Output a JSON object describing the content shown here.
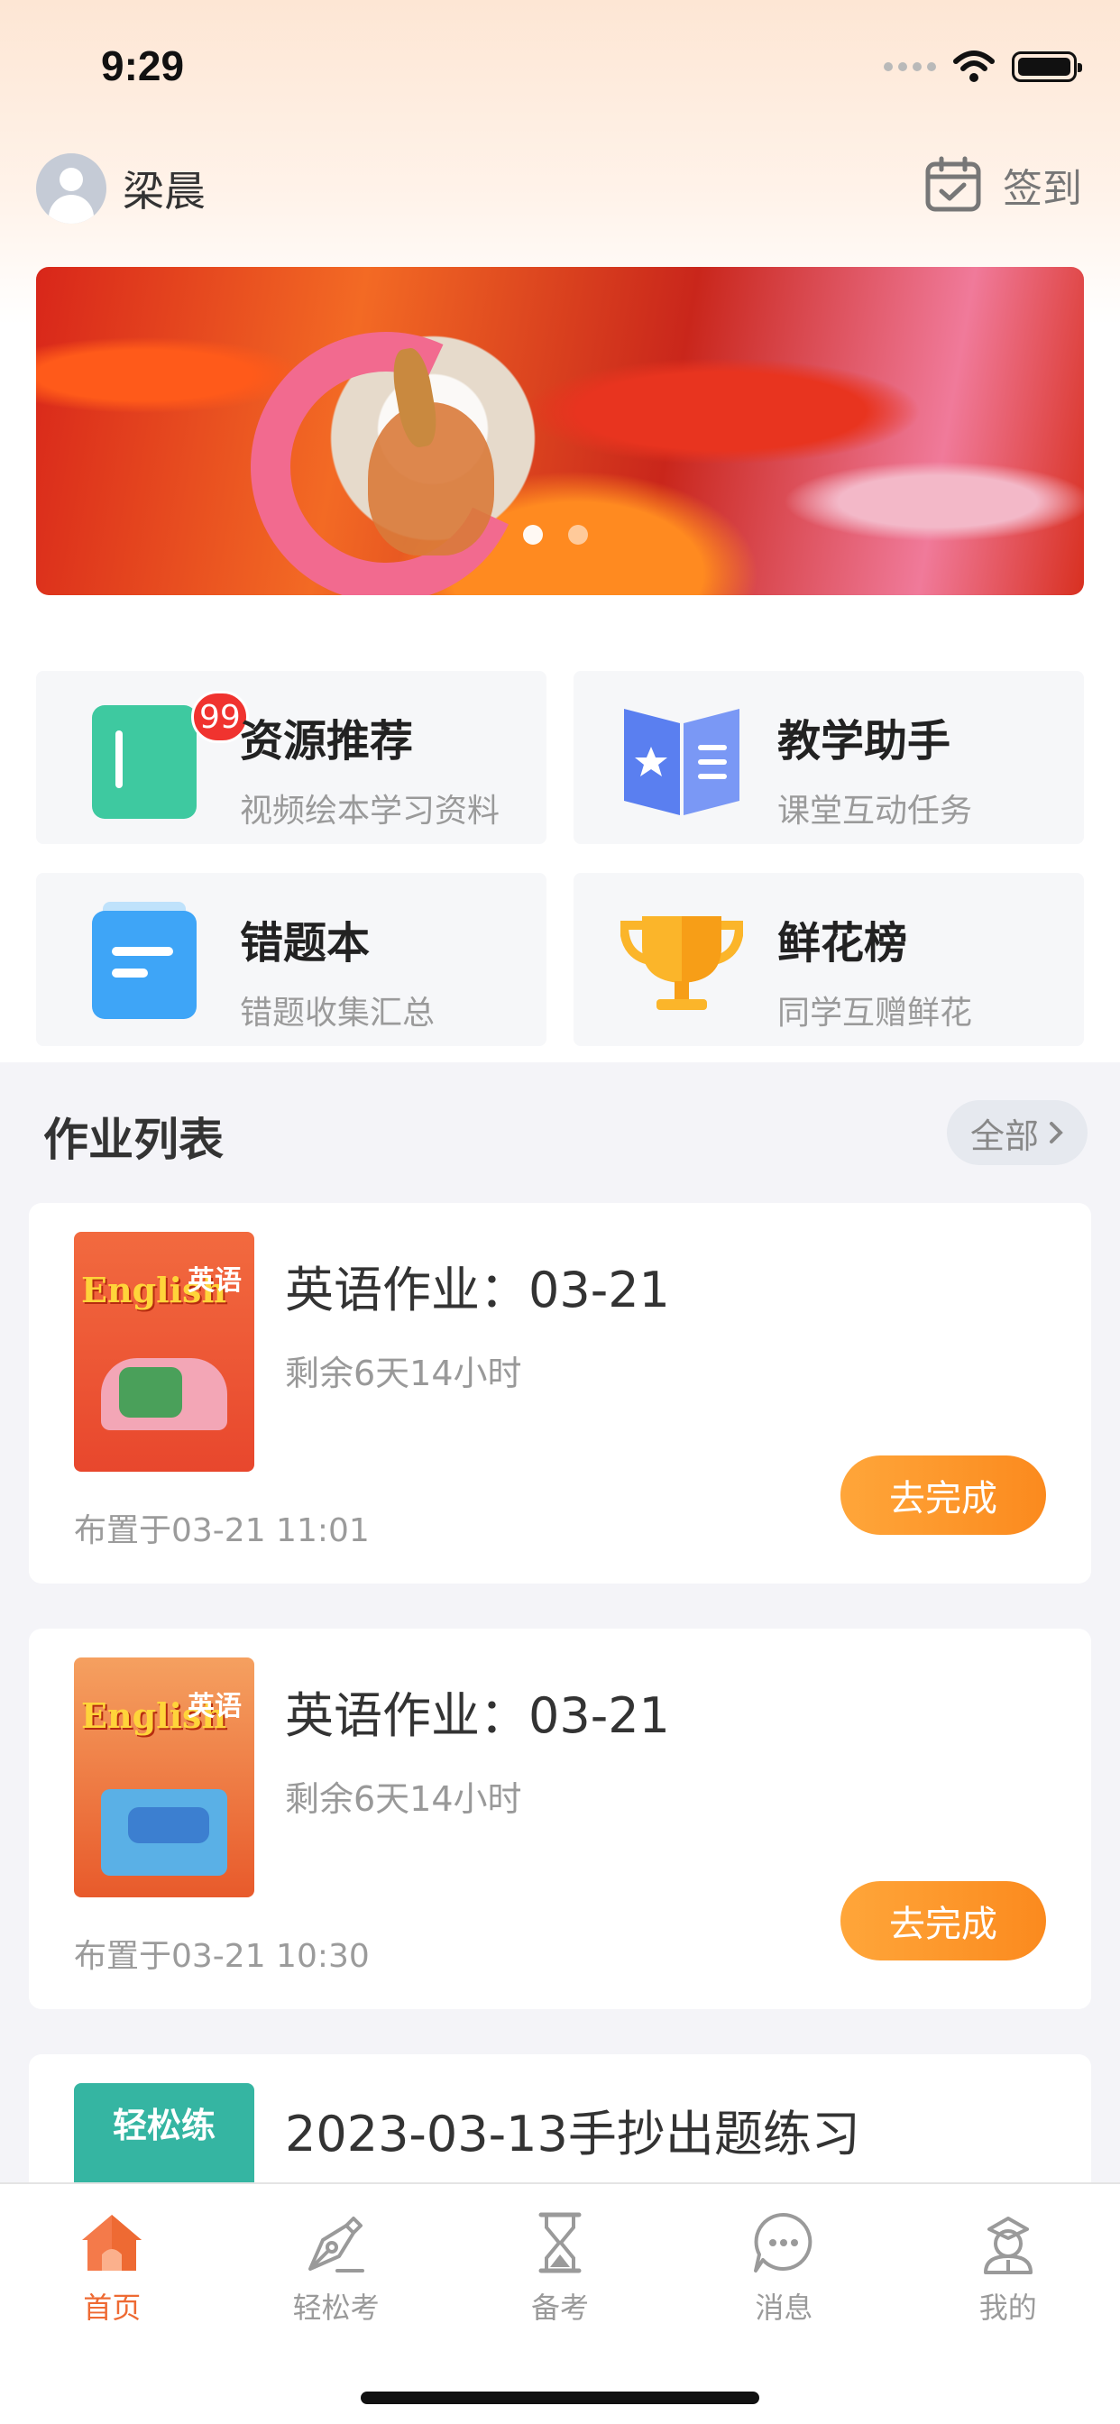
{
  "status_bar": {
    "time": "9:29"
  },
  "header": {
    "user_name": "梁晨",
    "signin_label": "签到"
  },
  "banner": {
    "page_count": 2,
    "active_index": 0
  },
  "features": [
    {
      "title": "资源推荐",
      "subtitle": "视频绘本学习资料",
      "icon": "resource-icon",
      "badge": "99",
      "color": "#3ec9a0"
    },
    {
      "title": "教学助手",
      "subtitle": "课堂互动任务",
      "icon": "open-book-icon",
      "color": "#5a7ff0"
    },
    {
      "title": "错题本",
      "subtitle": "错题收集汇总",
      "icon": "notebook-icon",
      "color": "#3ea5f7"
    },
    {
      "title": "鲜花榜",
      "subtitle": "同学互赠鲜花",
      "icon": "trophy-icon",
      "color": "#fbb52a"
    }
  ],
  "homework": {
    "section_title": "作业列表",
    "view_all_label": "全部",
    "items": [
      {
        "cover_en": "English",
        "cover_zh": "英语",
        "title": "英语作业：03-21",
        "remaining": "剩余6天14小时",
        "assigned": "布置于03-21 11:01",
        "action_label": "去完成"
      },
      {
        "cover_en": "English",
        "cover_zh": "英语",
        "title": "英语作业：03-21",
        "remaining": "剩余6天14小时",
        "assigned": "布置于03-21 10:30",
        "action_label": "去完成"
      },
      {
        "cover_zh": "轻松练",
        "title": "2023-03-13手抄出题练习"
      }
    ]
  },
  "tabbar": {
    "active_color": "#ee6a33",
    "tabs": [
      {
        "label": "首页",
        "icon": "home-icon",
        "active": true
      },
      {
        "label": "轻松考",
        "icon": "pen-nib-icon",
        "active": false
      },
      {
        "label": "备考",
        "icon": "hourglass-icon",
        "active": false
      },
      {
        "label": "消息",
        "icon": "chat-bubble-icon",
        "active": false
      },
      {
        "label": "我的",
        "icon": "profile-icon",
        "active": false
      }
    ]
  }
}
